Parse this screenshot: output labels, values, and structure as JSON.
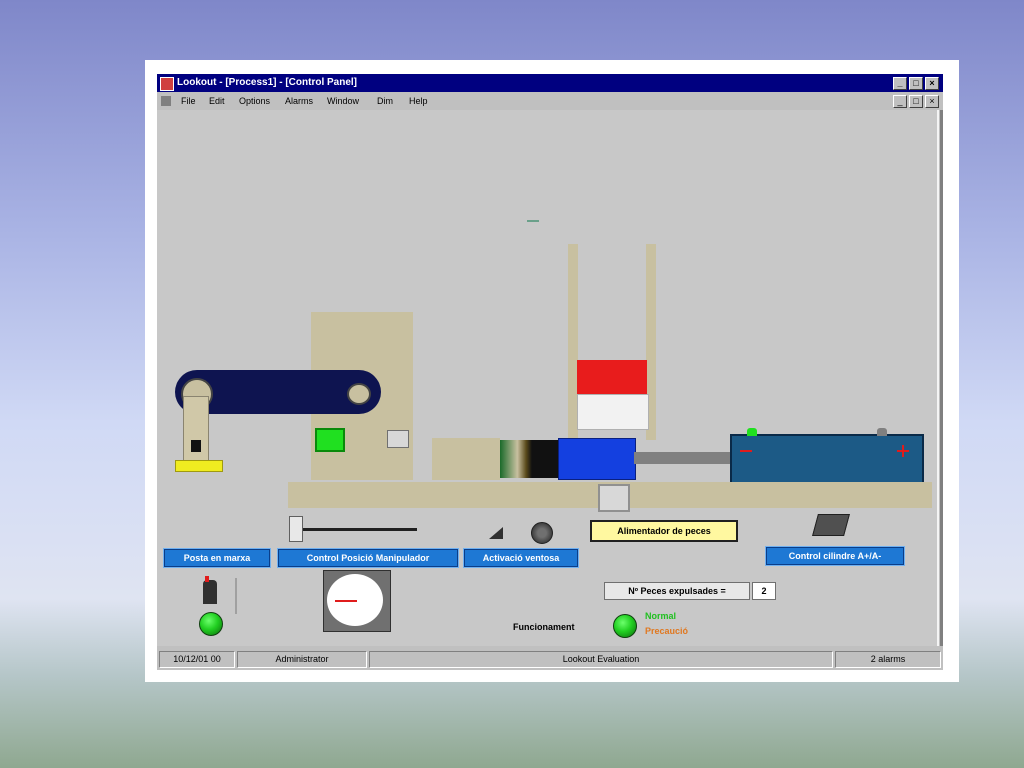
{
  "window": {
    "title": "Lookout - [Process1] - [Control Panel]",
    "buttons": [
      "_",
      "□",
      "×"
    ]
  },
  "menu": [
    "File",
    "Edit",
    "Options",
    "Alarms",
    "Window",
    "Dim",
    "Help"
  ],
  "panel": {
    "feeder_label": "Alimentador de peces",
    "buttons": {
      "start": "Posta en marxa",
      "manipulator": "Control Posició Manipulador",
      "vacuum": "Activació ventosa",
      "cylinder": "Control cilindre A+/A-"
    },
    "pieces_label": "Nº Peces expulsades =",
    "pieces_value": "2",
    "operation_label": "Funcionament",
    "state_normal": "Normal",
    "state_precaution": "Precaució",
    "colors": {
      "normal": "#20c020",
      "precaution": "#e07820",
      "cylinder": "#1c5a86",
      "piston": "#1440e0",
      "red_piece": "#e81c1c",
      "arm": "#0e1450",
      "accent_green": "#20e020"
    }
  },
  "statusbar": {
    "datetime": "10/12/01 00",
    "user": "Administrator",
    "mode": "Lookout Evaluation",
    "alarms": "2 alarms"
  }
}
